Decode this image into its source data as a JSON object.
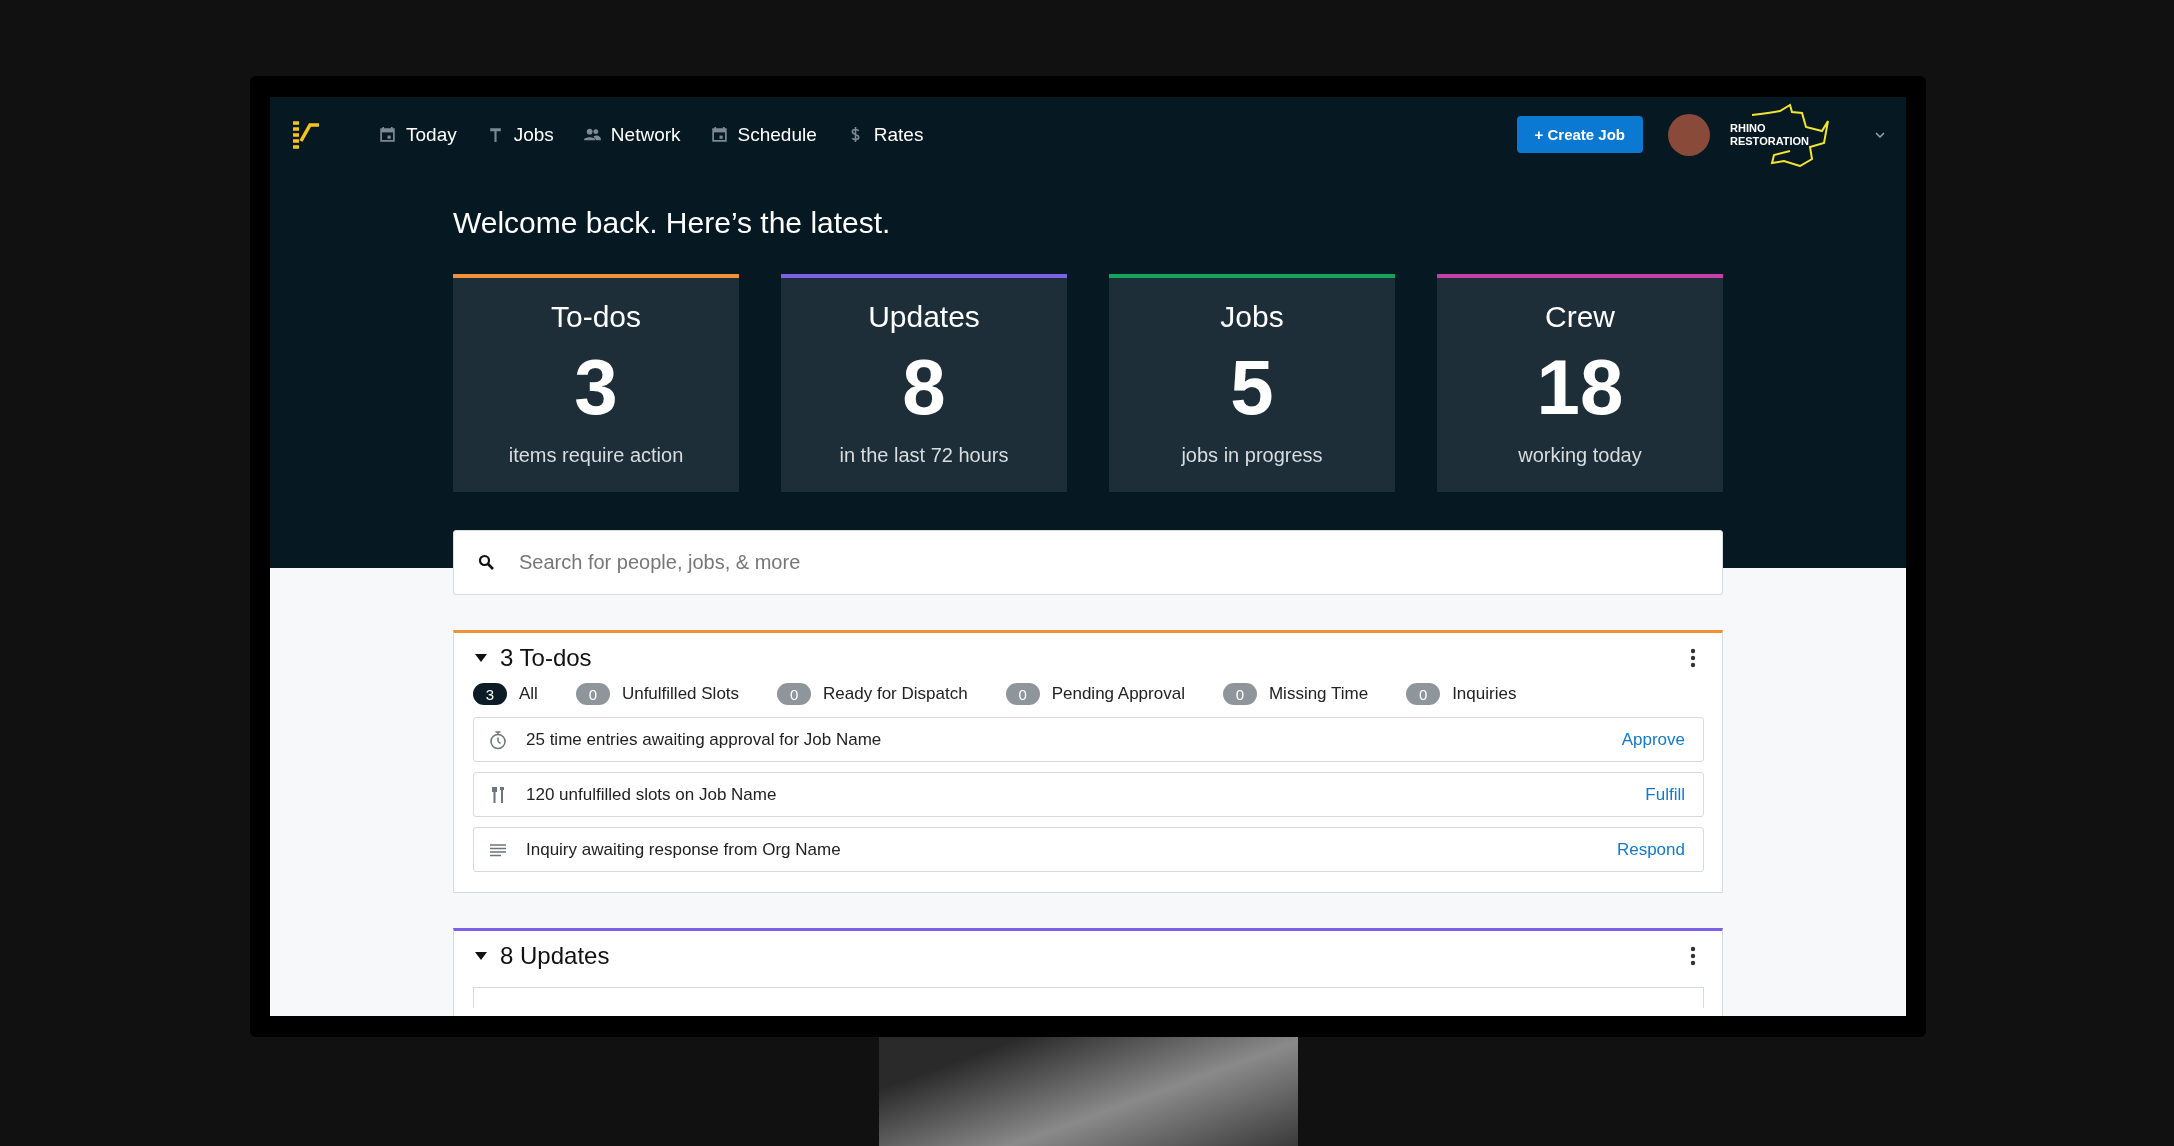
{
  "nav": {
    "items": [
      {
        "label": "Today",
        "kind": "calendar"
      },
      {
        "label": "Jobs",
        "kind": "hammer"
      },
      {
        "label": "Network",
        "kind": "people"
      },
      {
        "label": "Schedule",
        "kind": "calendar"
      },
      {
        "label": "Rates",
        "kind": "dollar"
      }
    ],
    "create_button": "+ Create Job",
    "company_logo": [
      "RHINO",
      "RESTORATION"
    ]
  },
  "welcome": "Welcome back. Here’s the latest.",
  "stats": [
    {
      "title": "To-dos",
      "value": "3",
      "caption": "items require action",
      "color": "#f0913a"
    },
    {
      "title": "Updates",
      "value": "8",
      "caption": "in the last 72 hours",
      "color": "#7b61e8"
    },
    {
      "title": "Jobs",
      "value": "5",
      "caption": "jobs in progress",
      "color": "#14a35c"
    },
    {
      "title": "Crew",
      "value": "18",
      "caption": "working today",
      "color": "#c43fa6"
    }
  ],
  "search": {
    "placeholder": "Search for people, jobs, & more"
  },
  "panels": [
    {
      "title": "3 To-dos",
      "expanded": true,
      "color": "#f0913a",
      "filters": [
        {
          "count": "3",
          "label": "All",
          "selected": true
        },
        {
          "count": "0",
          "label": "Unfulfilled Slots",
          "selected": false
        },
        {
          "count": "0",
          "label": "Ready for Dispatch",
          "selected": false
        },
        {
          "count": "0",
          "label": "Pending Approval",
          "selected": false
        },
        {
          "count": "0",
          "label": "Missing Time",
          "selected": false
        },
        {
          "count": "0",
          "label": "Inquiries",
          "selected": false
        }
      ],
      "items": [
        {
          "kind": "timer",
          "text": "25 time entries awaiting approval for Job Name",
          "action": "Approve"
        },
        {
          "kind": "tools",
          "text": "120 unfulfilled slots on Job Name",
          "action": "Fulfill"
        },
        {
          "kind": "message",
          "text": "Inquiry awaiting response from Org Name",
          "action": "Respond"
        }
      ]
    },
    {
      "title": "8 Updates",
      "expanded": true,
      "color": "#7b61e8"
    }
  ]
}
